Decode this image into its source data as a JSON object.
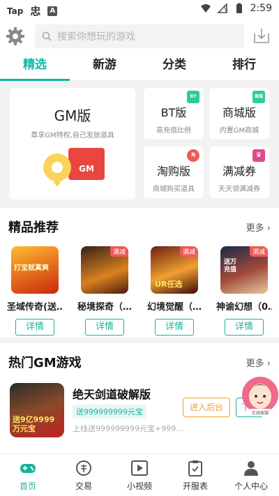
{
  "status_bar": {
    "app_icons": [
      "Tap",
      "忠",
      "A"
    ],
    "time": "2:59"
  },
  "search": {
    "placeholder": "搜索你想玩的游戏"
  },
  "tabs": [
    {
      "label": "精选",
      "active": true
    },
    {
      "label": "新游",
      "active": false
    },
    {
      "label": "分类",
      "active": false
    },
    {
      "label": "排行",
      "active": false
    }
  ],
  "categories": {
    "gm": {
      "title": "GM版",
      "subtitle": "尊享GM特权,自己发放道具",
      "logo_text": "GM"
    },
    "bt": {
      "title": "BT版",
      "subtitle": "高充值比例",
      "tag": "BT"
    },
    "mall": {
      "title": "商城版",
      "subtitle": "内置GM商城",
      "tag": "商城"
    },
    "taobao": {
      "title": "淘购版",
      "subtitle": "商城购买道具",
      "tag": "淘"
    },
    "coupon": {
      "title": "满减券",
      "subtitle": "天天领满减券",
      "tag": "♛"
    }
  },
  "featured": {
    "title": "精品推荐",
    "more": "更多",
    "games": [
      {
        "name": "圣域传奇(送…",
        "badge": "",
        "button": "详情",
        "cover_text": "打宝就真爽"
      },
      {
        "name": "秘境探奇（…",
        "badge": "满减",
        "button": "详情",
        "cover_text": ""
      },
      {
        "name": "幻境觉醒（…",
        "badge": "满减",
        "button": "详情",
        "cover_text": "UR任选"
      },
      {
        "name": "神谕幻想（0…",
        "badge": "满减",
        "button": "详情",
        "cover_text": "送万充值"
      }
    ]
  },
  "hot_gm": {
    "title": "热门GM游戏",
    "more": "更多",
    "item": {
      "title": "绝天剑道破解版",
      "tag": "送999999999元宝",
      "desc": "上线送999999999元宝+999…",
      "cover_text": "送9亿9999万元宝",
      "enter_button": "进入后台",
      "download_button": "下载"
    }
  },
  "support": {
    "label": "在线客服"
  },
  "bottom_nav": [
    {
      "label": "首页",
      "active": true
    },
    {
      "label": "交易",
      "active": false
    },
    {
      "label": "小视频",
      "active": false
    },
    {
      "label": "开服表",
      "active": false
    },
    {
      "label": "个人中心",
      "active": false
    }
  ],
  "colors": {
    "accent": "#18b39c",
    "badge_red": "#ef5a57",
    "enter_orange": "#f0a030"
  }
}
